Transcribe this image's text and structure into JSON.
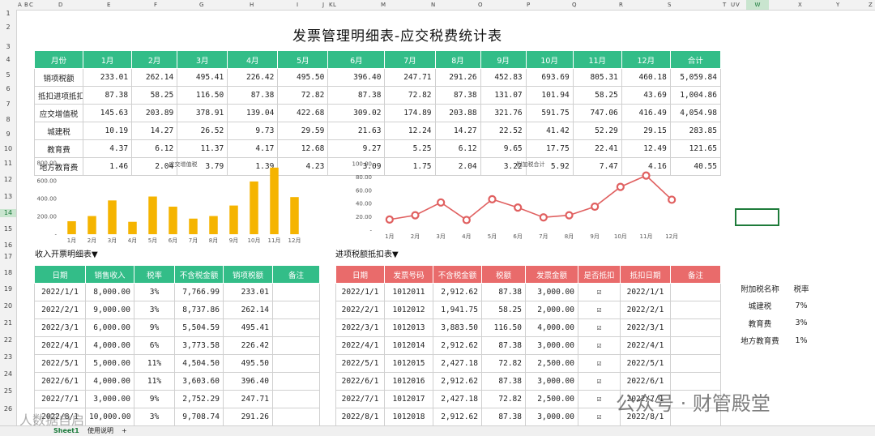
{
  "column_headers": [
    "A",
    "B",
    "C",
    "D",
    "E",
    "F",
    "G",
    "H",
    "I",
    "J",
    "K",
    "L",
    "M",
    "N",
    "O",
    "P",
    "Q",
    "R",
    "S",
    "T",
    "U",
    "V",
    "W",
    "X",
    "Y",
    "Z"
  ],
  "row_headers": [
    "1",
    "2",
    "3",
    "4",
    "5",
    "6",
    "7",
    "8",
    "9",
    "10",
    "11",
    "12",
    "13",
    "14",
    "15",
    "16",
    "17",
    "18",
    "19",
    "20",
    "21",
    "22",
    "23",
    "24",
    "25",
    "26"
  ],
  "title": "发票管理明细表-应交税费统计表",
  "summary": {
    "headers": [
      "月份",
      "1月",
      "2月",
      "3月",
      "4月",
      "5月",
      "6月",
      "7月",
      "8月",
      "9月",
      "10月",
      "11月",
      "12月",
      "合计"
    ],
    "rows": [
      [
        "销项税额",
        "233.01",
        "262.14",
        "495.41",
        "226.42",
        "495.50",
        "396.40",
        "247.71",
        "291.26",
        "452.83",
        "693.69",
        "805.31",
        "460.18",
        "5,059.84"
      ],
      [
        "抵扣进项抵扣",
        "87.38",
        "58.25",
        "116.50",
        "87.38",
        "72.82",
        "87.38",
        "72.82",
        "87.38",
        "131.07",
        "101.94",
        "58.25",
        "43.69",
        "1,004.86"
      ],
      [
        "应交增值税",
        "145.63",
        "203.89",
        "378.91",
        "139.04",
        "422.68",
        "309.02",
        "174.89",
        "203.88",
        "321.76",
        "591.75",
        "747.06",
        "416.49",
        "4,054.98"
      ],
      [
        "城建税",
        "10.19",
        "14.27",
        "26.52",
        "9.73",
        "29.59",
        "21.63",
        "12.24",
        "14.27",
        "22.52",
        "41.42",
        "52.29",
        "29.15",
        "283.85"
      ],
      [
        "教育费",
        "4.37",
        "6.12",
        "11.37",
        "4.17",
        "12.68",
        "9.27",
        "5.25",
        "6.12",
        "9.65",
        "17.75",
        "22.41",
        "12.49",
        "121.65"
      ],
      [
        "地方教育费",
        "1.46",
        "2.04",
        "3.79",
        "1.39",
        "4.23",
        "3.09",
        "1.75",
        "2.04",
        "3.22",
        "5.92",
        "7.47",
        "4.16",
        "40.55"
      ]
    ]
  },
  "chart_data": [
    {
      "type": "bar",
      "title": "应交增值税",
      "categories": [
        "1月",
        "2月",
        "3月",
        "4月",
        "5月",
        "6月",
        "7月",
        "8月",
        "9月",
        "10月",
        "11月",
        "12月"
      ],
      "values": [
        145.63,
        203.89,
        378.91,
        139.04,
        422.68,
        309.02,
        174.89,
        203.88,
        321.76,
        591.75,
        747.06,
        416.49
      ],
      "ylim": [
        0,
        800
      ],
      "yticks": [
        "-",
        "200.00",
        "400.00",
        "600.00",
        "800.00"
      ],
      "color": "#f5b400"
    },
    {
      "type": "line",
      "title": "附加税合计",
      "categories": [
        "1月",
        "2月",
        "3月",
        "4月",
        "5月",
        "6月",
        "7月",
        "8月",
        "9月",
        "10月",
        "11月",
        "12月"
      ],
      "values": [
        16.02,
        22.43,
        41.68,
        15.29,
        46.5,
        33.99,
        19.24,
        22.43,
        35.39,
        65.09,
        82.17,
        45.8
      ],
      "ylim": [
        0,
        100
      ],
      "yticks": [
        "-",
        "20.00",
        "40.00",
        "60.00",
        "80.00",
        "100.00"
      ],
      "color": "#e06060"
    }
  ],
  "income": {
    "label": "收入开票明细表▼",
    "headers": [
      "日期",
      "销售收入",
      "税率",
      "不含税金额",
      "销项税额",
      "备注"
    ],
    "rows": [
      [
        "2022/1/1",
        "8,000.00",
        "3%",
        "7,766.99",
        "233.01",
        ""
      ],
      [
        "2022/2/1",
        "9,000.00",
        "3%",
        "8,737.86",
        "262.14",
        ""
      ],
      [
        "2022/3/1",
        "6,000.00",
        "9%",
        "5,504.59",
        "495.41",
        ""
      ],
      [
        "2022/4/1",
        "4,000.00",
        "6%",
        "3,773.58",
        "226.42",
        ""
      ],
      [
        "2022/5/1",
        "5,000.00",
        "11%",
        "4,504.50",
        "495.50",
        ""
      ],
      [
        "2022/6/1",
        "4,000.00",
        "11%",
        "3,603.60",
        "396.40",
        ""
      ],
      [
        "2022/7/1",
        "3,000.00",
        "9%",
        "2,752.29",
        "247.71",
        ""
      ],
      [
        "2022/8/1",
        "10,000.00",
        "3%",
        "9,708.74",
        "291.26",
        ""
      ]
    ]
  },
  "input": {
    "label": "进项税额抵扣表▼",
    "headers": [
      "日期",
      "发票号码",
      "不含税金额",
      "税额",
      "发票金额",
      "是否抵扣",
      "抵扣日期",
      "备注"
    ],
    "rows": [
      [
        "2022/1/1",
        "1012011",
        "2,912.62",
        "87.38",
        "3,000.00",
        "☑",
        "2022/1/1",
        ""
      ],
      [
        "2022/2/1",
        "1012012",
        "1,941.75",
        "58.25",
        "2,000.00",
        "☑",
        "2022/2/1",
        ""
      ],
      [
        "2022/3/1",
        "1012013",
        "3,883.50",
        "116.50",
        "4,000.00",
        "☑",
        "2022/3/1",
        ""
      ],
      [
        "2022/4/1",
        "1012014",
        "2,912.62",
        "87.38",
        "3,000.00",
        "☑",
        "2022/4/1",
        ""
      ],
      [
        "2022/5/1",
        "1012015",
        "2,427.18",
        "72.82",
        "2,500.00",
        "☑",
        "2022/5/1",
        ""
      ],
      [
        "2022/6/1",
        "1012016",
        "2,912.62",
        "87.38",
        "3,000.00",
        "☑",
        "2022/6/1",
        ""
      ],
      [
        "2022/7/1",
        "1012017",
        "2,427.18",
        "72.82",
        "2,500.00",
        "☑",
        "2022/7/1",
        ""
      ],
      [
        "2022/8/1",
        "1012018",
        "2,912.62",
        "87.38",
        "3,000.00",
        "☑",
        "2022/8/1",
        ""
      ]
    ]
  },
  "surtax": {
    "headers": [
      "附加税名称",
      "税率"
    ],
    "rows": [
      [
        "城建税",
        "7%"
      ],
      [
        "教育费",
        "3%"
      ],
      [
        "地方教育费",
        "1%"
      ]
    ]
  },
  "tabs": [
    "Sheet1",
    "使用说明",
    "+"
  ],
  "watermark": "公众号 · 财管殿堂",
  "watermark2": "人数据自启"
}
